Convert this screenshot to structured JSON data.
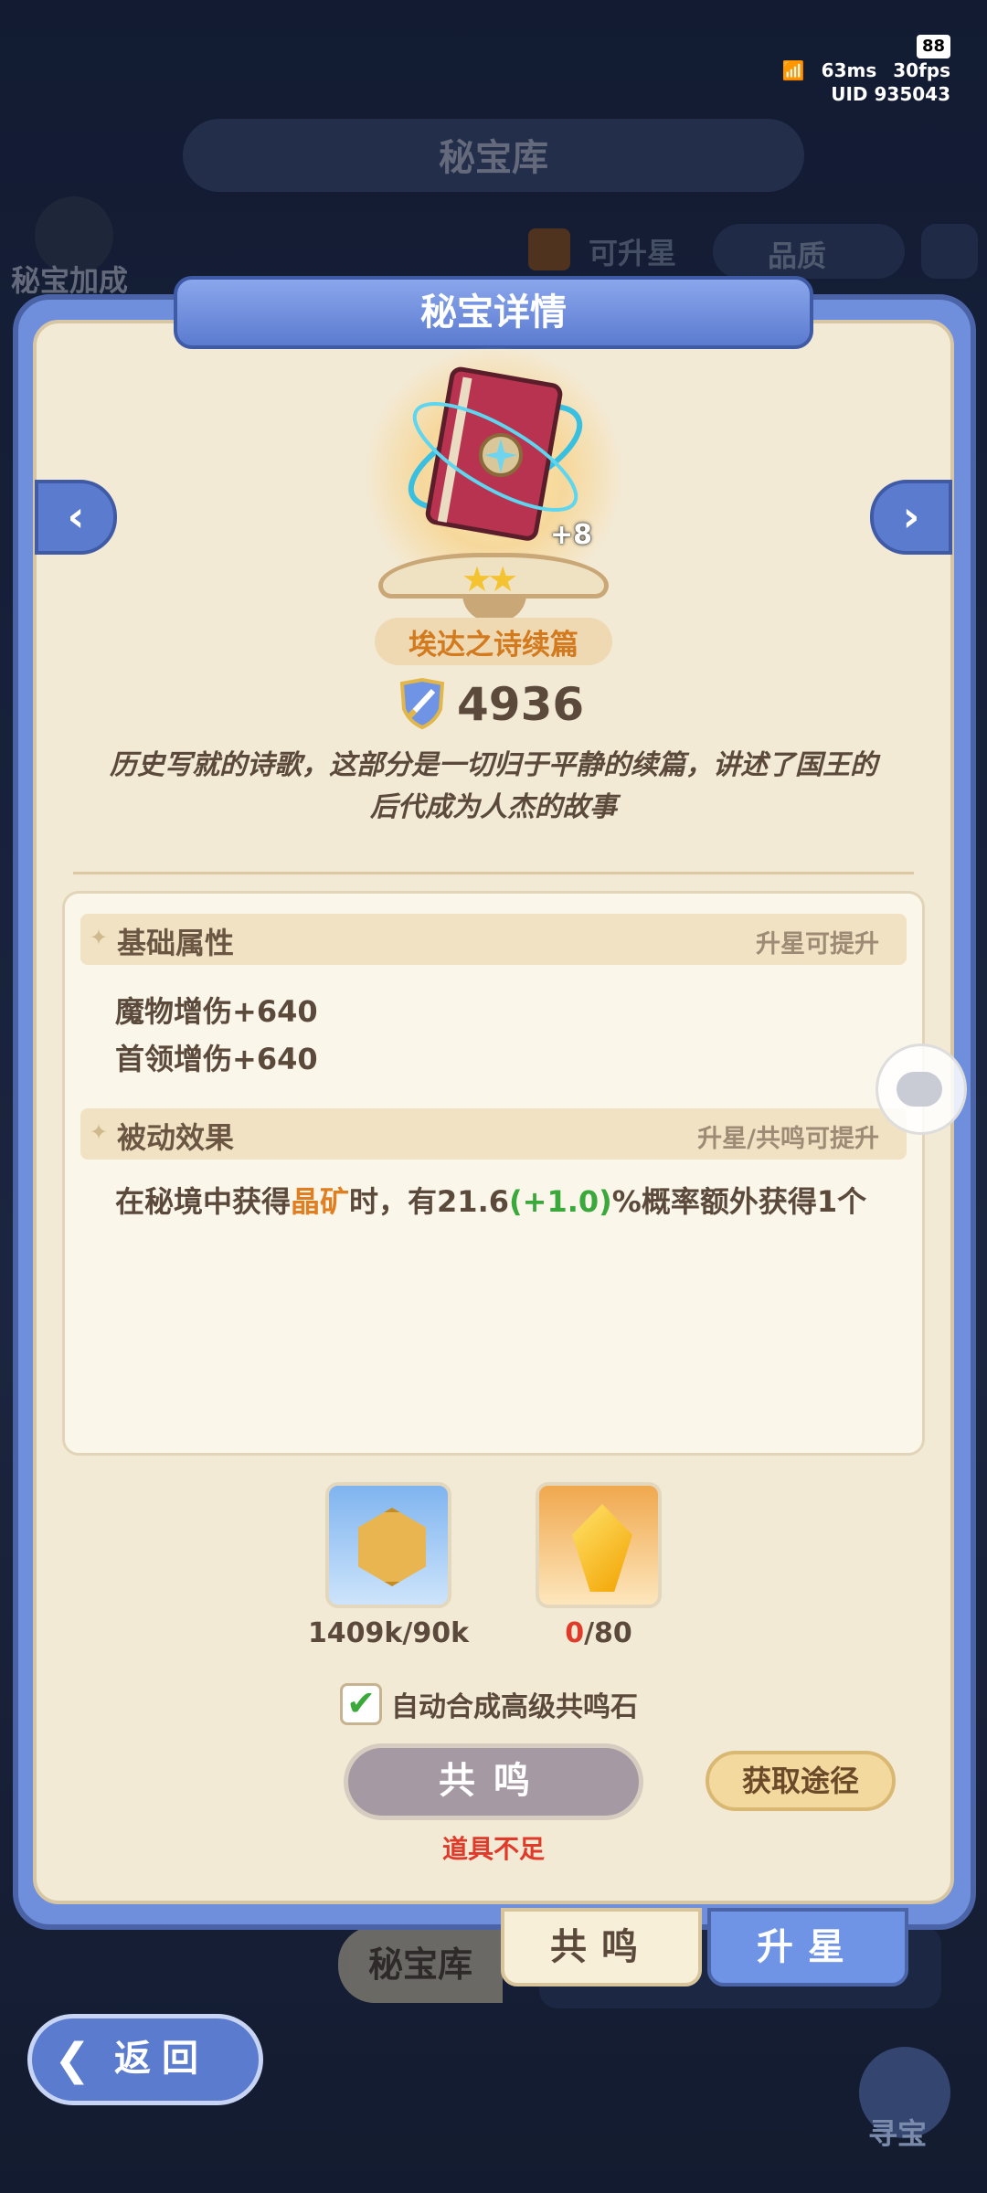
{
  "hud": {
    "ping": "63ms",
    "fps": "30fps",
    "uid": "UID 935043",
    "battery": "88"
  },
  "background": {
    "title": "秘宝库",
    "bonus_label": "秘宝加成",
    "upgradable_label": "可升星",
    "quality_label": "品质",
    "library_tab": "秘宝库",
    "treasure_hunt": "寻宝"
  },
  "modal": {
    "title": "秘宝详情",
    "item": {
      "name": "埃达之诗续篇",
      "level": "+8",
      "stars": "★★",
      "power": "4936",
      "description": "历史写就的诗歌，这部分是一切归于平静的续篇，讲述了国王的后代成为人杰的故事"
    },
    "base_attr": {
      "title": "基础属性",
      "hint": "升星可提升",
      "lines": [
        "魔物增伤+640",
        "首领增伤+640"
      ]
    },
    "passive": {
      "title": "被动效果",
      "hint": "升星/共鸣可提升",
      "text_before": "在秘境中获得",
      "text_highlight": "晶矿",
      "text_mid": "时，有21.6",
      "text_bonus": "(+1.0)",
      "text_after": "%概率额外获得1个"
    },
    "materials": [
      {
        "name": "coin",
        "count": "1409k/90k"
      },
      {
        "name": "gem",
        "count_have": "0",
        "count_need": "/80"
      }
    ],
    "auto_merge_label": "自动合成高级共鸣石",
    "auto_merge_checked": "✔",
    "resonate_button": "共鸣",
    "obtain_button": "获取途径",
    "insufficient": "道具不足",
    "tabs": {
      "resonate": "共鸣",
      "upstar": "升星"
    }
  },
  "back_button": "返回",
  "colors": {
    "accent_blue": "#5b7bcf",
    "panel_cream": "#f3ead6",
    "highlight_orange": "#e07f22",
    "bonus_green": "#3aa83a",
    "error_red": "#e03a2a"
  }
}
